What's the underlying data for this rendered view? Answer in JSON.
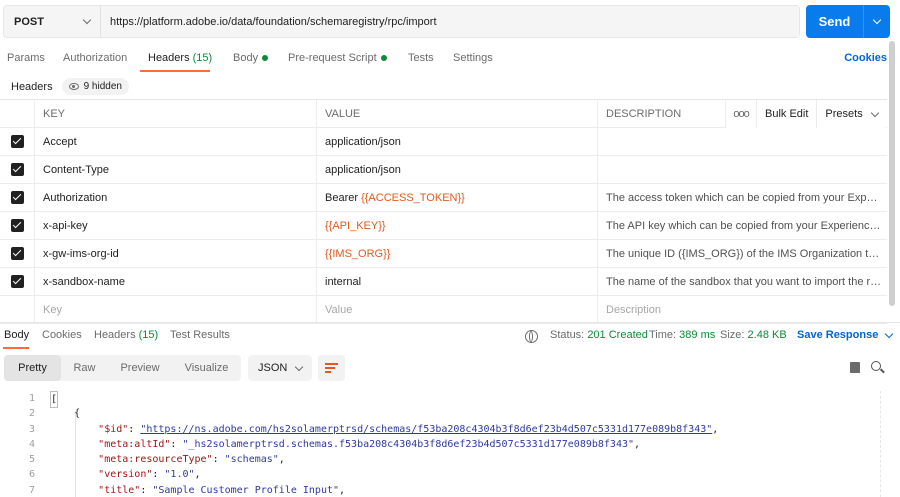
{
  "request": {
    "method": "POST",
    "url": "https://platform.adobe.io/data/foundation/schemaregistry/rpc/import",
    "send_label": "Send"
  },
  "request_tabs": {
    "params": "Params",
    "authorization": "Authorization",
    "headers": "Headers",
    "headers_count": "(15)",
    "body": "Body",
    "prerequest": "Pre-request Script",
    "tests": "Tests",
    "settings": "Settings",
    "cookies": "Cookies"
  },
  "headers_section": {
    "title": "Headers",
    "hidden": "9 hidden"
  },
  "table": {
    "columns": {
      "key": "KEY",
      "value": "VALUE",
      "description": "DESCRIPTION"
    },
    "tools": {
      "more": "ooo",
      "bulk_edit": "Bulk Edit",
      "presets": "Presets"
    },
    "rows": [
      {
        "key": "Accept",
        "value": "application/json",
        "value_var": false,
        "description": ""
      },
      {
        "key": "Content-Type",
        "value": "application/json",
        "value_var": false,
        "description": ""
      },
      {
        "key": "Authorization",
        "value_prefix": "Bearer ",
        "value": "{{ACCESS_TOKEN}}",
        "value_var": true,
        "description": "The access token which can be copied from your Experi..."
      },
      {
        "key": "x-api-key",
        "value": "{{API_KEY}}",
        "value_var": true,
        "description": "The API key which can be copied from your Experience ..."
      },
      {
        "key": "x-gw-ims-org-id",
        "value": "{{IMS_ORG}}",
        "value_var": true,
        "description": "The unique ID ({IMS_ORG}) of the IMS Organization that ..."
      },
      {
        "key": "x-sandbox-name",
        "value": "internal",
        "value_var": false,
        "description": "The name of the sandbox that you want to import the re..."
      }
    ],
    "placeholders": {
      "key": "Key",
      "value": "Value",
      "description": "Description"
    }
  },
  "response_tabs": {
    "body": "Body",
    "cookies": "Cookies",
    "headers": "Headers",
    "headers_count": "(15)",
    "test_results": "Test Results"
  },
  "response_status": {
    "status_label": "Status:",
    "status_value": "201 Created",
    "time_label": "Time:",
    "time_value": "389 ms",
    "size_label": "Size:",
    "size_value": "2.48 KB",
    "save_response": "Save Response"
  },
  "response_toolbar": {
    "views": [
      "Pretty",
      "Raw",
      "Preview",
      "Visualize"
    ],
    "format": "JSON"
  },
  "code_lines": [
    {
      "n": "1",
      "text": "["
    },
    {
      "n": "2",
      "text": "    {"
    },
    {
      "n": "3",
      "key": "\"$id\"",
      "value": "\"https://ns.adobe.com/hs2solamerptrsd/schemas/f53ba208c4304b3f8d6ef23b4d507c5331d177e089b8f343\"",
      "link": true
    },
    {
      "n": "4",
      "key": "\"meta:altId\"",
      "value": "\"_hs2solamerptrsd.schemas.f53ba208c4304b3f8d6ef23b4d507c5331d177e089b8f343\""
    },
    {
      "n": "5",
      "key": "\"meta:resourceType\"",
      "value": "\"schemas\""
    },
    {
      "n": "6",
      "key": "\"version\"",
      "value": "\"1.0\""
    },
    {
      "n": "7",
      "key": "\"title\"",
      "value": "\"Sample Customer Profile Input\""
    }
  ]
}
